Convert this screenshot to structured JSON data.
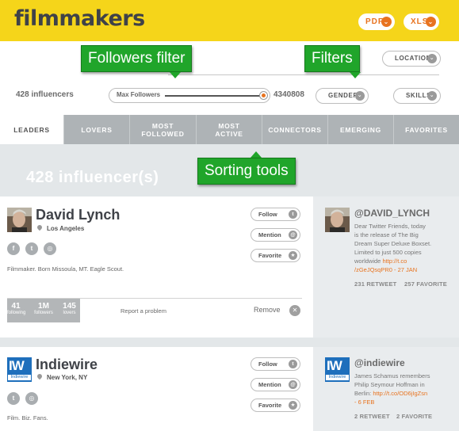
{
  "header": {
    "title": "filmmakers",
    "pdf_label": "PDF",
    "xls_label": "XLS"
  },
  "filters": {
    "influencer_count": "428 influencers",
    "slider_label": "Max Followers",
    "slider_max": "4340808",
    "slider_fill": 1.0,
    "location_label": "LOCATION",
    "gender_label": "GENDER",
    "skills_label": "SKILLS"
  },
  "callouts": {
    "followers_filter": "Followers filter",
    "filters": "Filters",
    "sorting_tools": "Sorting tools"
  },
  "tabs": [
    {
      "label": "LEADERS"
    },
    {
      "label": "LOVERS"
    },
    {
      "label": "MOST\nFOLLOWED"
    },
    {
      "label": "MOST\nACTIVE"
    },
    {
      "label": "CONNECTORS"
    },
    {
      "label": "EMERGING"
    },
    {
      "label": "FAVORITES"
    }
  ],
  "results": {
    "banner": "428 influencer(s)"
  },
  "actions": {
    "follow": "Follow",
    "mention": "Mention",
    "favorite": "Favorite",
    "mention_symbol": "@",
    "favorite_symbol": "★"
  },
  "influencers": [
    {
      "name": "David Lynch",
      "location": "Los Angeles",
      "bio": "Filmmaker. Born Missoula, MT. Eagle Scout.",
      "stats": [
        {
          "value": "41",
          "label": "following"
        },
        {
          "value": "1M",
          "label": "followers"
        },
        {
          "value": "145",
          "label": "lovers"
        }
      ],
      "report": "Report a problem",
      "remove": "Remove",
      "handle": "@DAVID_LYNCH",
      "tweet_lines": [
        "Dear Twitter Friends, today",
        "is the release of The Big",
        "Dream Super Deluxe Boxset.",
        "Limited to just 500 copies"
      ],
      "tweet_prefix": "worldwide ",
      "tweet_link1": "http://t.co",
      "tweet_link2": "/zGeJQsqPR0 - 27 JAN",
      "retweets": "231 RETWEET",
      "favorites": "257 FAVORITE"
    },
    {
      "name": "Indiewire",
      "location": "New York, NY",
      "bio": "Film. Biz. Fans.",
      "logo_big": "IW",
      "logo_small": "Indiewire",
      "handle": "@indiewire",
      "tweet_lines": [
        "James Schamus remembers",
        "Philip Seymour Hoffman in"
      ],
      "tweet_prefix": "Berlin: ",
      "tweet_link1": "http://t.co/OD6jIgZsn",
      "tweet_link2": "- 6 FEB",
      "retweets": "2 RETWEET",
      "favorites": "2 FAVORITE"
    }
  ],
  "colors": {
    "brand_yellow": "#f5d51a",
    "accent_orange": "#e8731f",
    "callout_green": "#20a52a",
    "tab_gray": "#aeb3b6"
  }
}
